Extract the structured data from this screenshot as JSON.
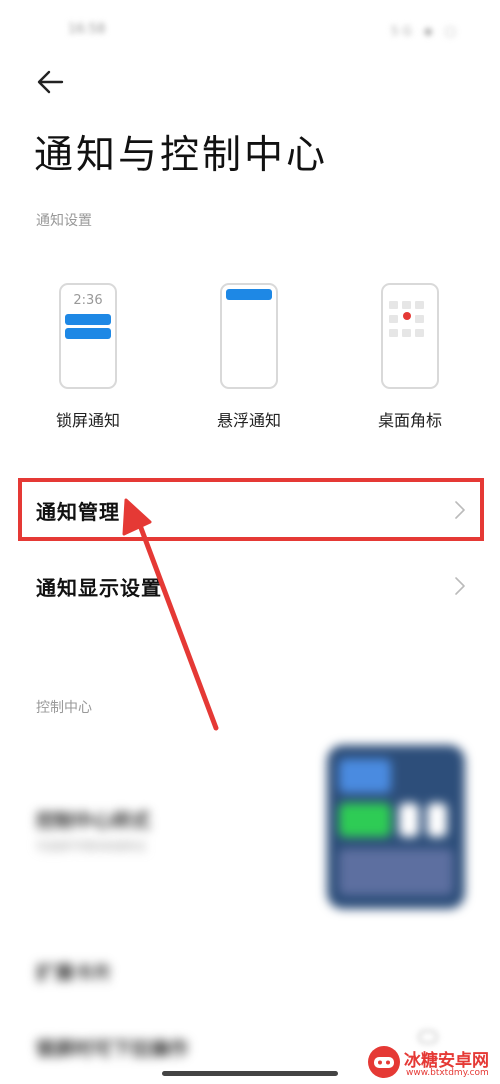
{
  "status_bar": {
    "time": "16:58",
    "icons": "5G ◆ ▢"
  },
  "page": {
    "title": "通知与控制中心"
  },
  "notification_settings": {
    "section_label": "通知设置",
    "styles": [
      {
        "label": "锁屏通知",
        "preview_time": "2:36"
      },
      {
        "label": "悬浮通知"
      },
      {
        "label": "桌面角标"
      }
    ]
  },
  "list": {
    "items": [
      {
        "label": "通知管理"
      },
      {
        "label": "通知显示设置"
      }
    ]
  },
  "control_center": {
    "section_label": "控制中心",
    "style_row": {
      "title": "控制中心样式",
      "subtitle": "可选择不同的系统样式"
    },
    "expand_row": {
      "title": "扩展卡片"
    },
    "lock_row": {
      "title": "锁屏时可下拉操作"
    }
  },
  "watermark": {
    "name": "冰糖安卓网",
    "url": "www.btxtdmy.com"
  },
  "colors": {
    "accent_blue": "#1e88e5",
    "highlight_red": "#e53935",
    "badge_red": "#e53935"
  }
}
